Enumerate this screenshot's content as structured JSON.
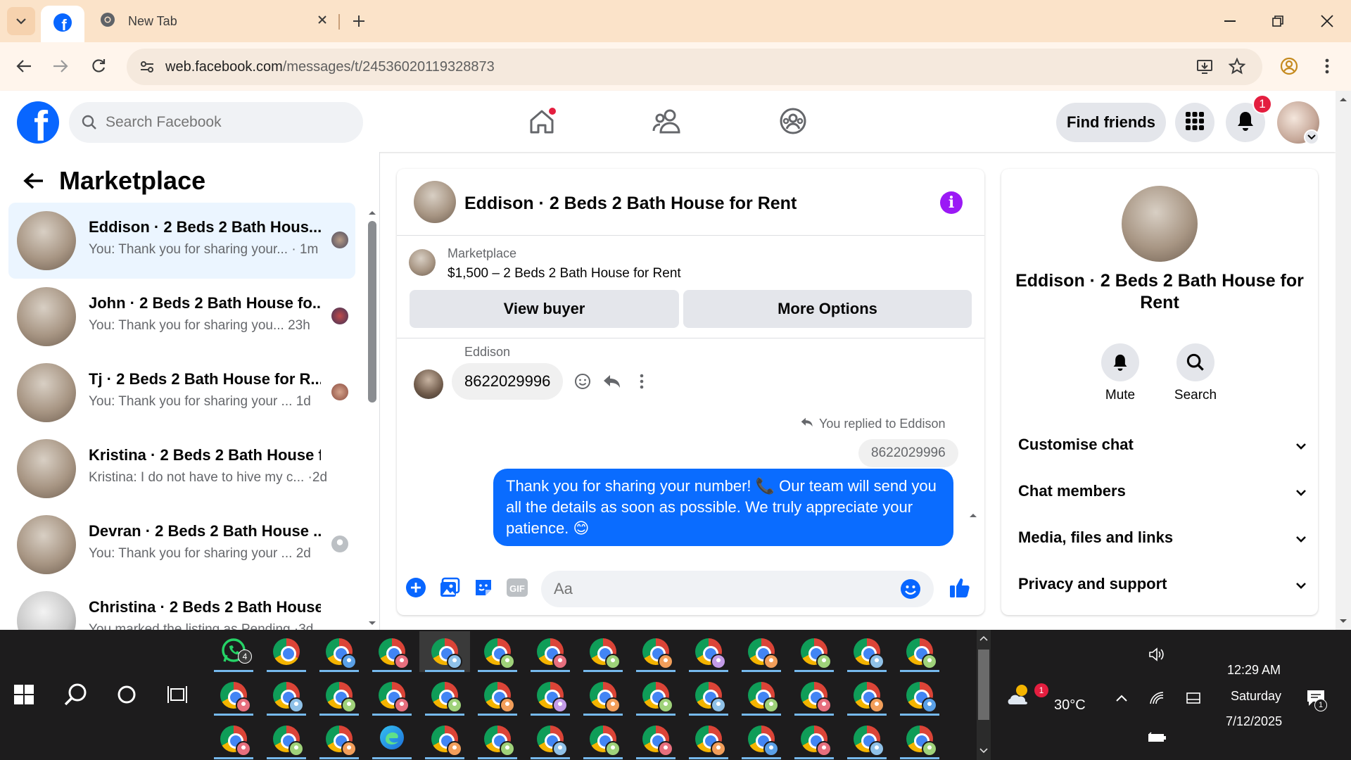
{
  "browser": {
    "tabs": [
      {
        "title": "",
        "icon": "facebook-icon",
        "active": true
      },
      {
        "title": "New Tab",
        "icon": "chrome-icon",
        "active": false
      }
    ],
    "url_host": "web.facebook.com",
    "url_path": "/messages/t/24536020119328873"
  },
  "fb_header": {
    "search_placeholder": "Search Facebook",
    "find_friends_label": "Find friends",
    "notification_count": "1"
  },
  "left_panel": {
    "title": "Marketplace",
    "conversations": [
      {
        "name": "Eddison · 2 Beds 2 Bath Hous...",
        "preview": "You: Thank you for sharing your... · 1m",
        "preview_text": "You: Thank you for sharing your...",
        "time": "1m",
        "active": true
      },
      {
        "name": "John · 2 Beds 2 Bath House fo...",
        "preview_text": "You: Thank you for sharing you...",
        "time": "23h",
        "active": false
      },
      {
        "name": "Tj · 2 Beds 2 Bath House for R...",
        "preview_text": "You: Thank you for sharing your ...",
        "time": "1d",
        "active": false
      },
      {
        "name": "Kristina · 2 Beds 2 Bath House f...",
        "preview_text": "Kristina: I do not have to hive my c... ·",
        "time": "2d",
        "active": false
      },
      {
        "name": "Devran · 2 Beds 2 Bath House ...",
        "preview_text": "You: Thank you for sharing your ...",
        "time": "2d",
        "active": false
      },
      {
        "name": "Christina · 2 Beds 2 Bath House ...",
        "preview_text": "You marked the listing as Pending ·",
        "time": "3d",
        "active": false
      }
    ]
  },
  "chat": {
    "title": "Eddison · 2 Beds 2 Bath House for Rent",
    "listing_source": "Marketplace",
    "listing_title": "$1,500 – 2 Beds 2 Bath House for Rent",
    "view_buyer_label": "View buyer",
    "more_options_label": "More Options",
    "incoming_sender": "Eddison",
    "incoming_text": "8622029996",
    "replied_note": "You replied to Eddison",
    "quoted_text": "8622029996",
    "outgoing_text": "Thank you for sharing your number! 📞 Our team will send you all the details as soon as possible. We truly appreciate your patience. 😊",
    "composer_placeholder": "Aa"
  },
  "info_panel": {
    "name": "Eddison · 2 Beds 2 Bath House for Rent",
    "mute_label": "Mute",
    "search_label": "Search",
    "sections": [
      "Customise chat",
      "Chat members",
      "Media, files and links",
      "Privacy and support"
    ]
  },
  "taskbar": {
    "whatsapp_badge": "4",
    "weather_badge": "1",
    "temperature": "30°C",
    "time": "12:29 AM",
    "day": "Saturday",
    "date": "7/12/2025",
    "notification_badge": "1"
  }
}
